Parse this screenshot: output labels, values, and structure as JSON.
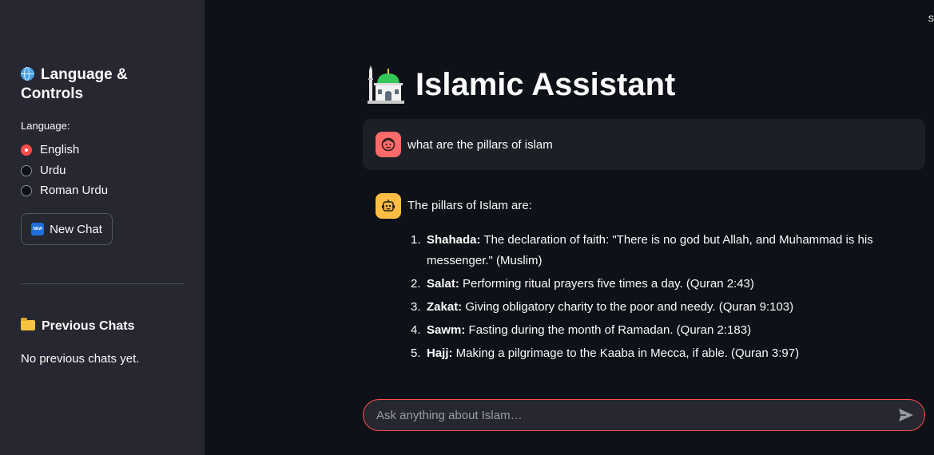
{
  "sidebar": {
    "title": "Language & Controls",
    "language_label": "Language:",
    "language_options": [
      "English",
      "Urdu",
      "Roman Urdu"
    ],
    "selected_language": "English",
    "new_chat_label": "New Chat",
    "new_chat_badge": "NEW",
    "previous_chats_title": "Previous Chats",
    "no_chats_text": "No previous chats yet."
  },
  "header": {
    "title": "Islamic Assistant",
    "corner_text": "S"
  },
  "chat": {
    "user_message": "what are the pillars of islam",
    "assistant_intro": "The pillars of Islam are:",
    "pillars": [
      {
        "num": "1.",
        "name": "Shahada:",
        "text": " The declaration of faith: \"There is no god but Allah, and Muhammad is his messenger.\" (Muslim)"
      },
      {
        "num": "2.",
        "name": "Salat:",
        "text": " Performing ritual prayers five times a day. (Quran 2:43)"
      },
      {
        "num": "3.",
        "name": "Zakat:",
        "text": " Giving obligatory charity to the poor and needy. (Quran 9:103)"
      },
      {
        "num": "4.",
        "name": "Sawm:",
        "text": " Fasting during the month of Ramadan. (Quran 2:183)"
      },
      {
        "num": "5.",
        "name": "Hajj:",
        "text": " Making a pilgrimage to the Kaaba in Mecca, if able. (Quran 3:97)"
      }
    ]
  },
  "input": {
    "placeholder": "Ask anything about Islam…",
    "value": ""
  },
  "colors": {
    "accent": "#ff4b4b",
    "background": "#0e1117",
    "sidebar": "#262730",
    "user_avatar": "#ff6b6b",
    "bot_avatar": "#ffbd45"
  },
  "icons": {
    "globe": "globe-icon",
    "mosque": "mosque-icon",
    "new_chat": "new-badge-icon",
    "folder": "folder-icon",
    "user_avatar": "user-face-icon",
    "bot_avatar": "robot-icon",
    "send": "send-icon"
  }
}
